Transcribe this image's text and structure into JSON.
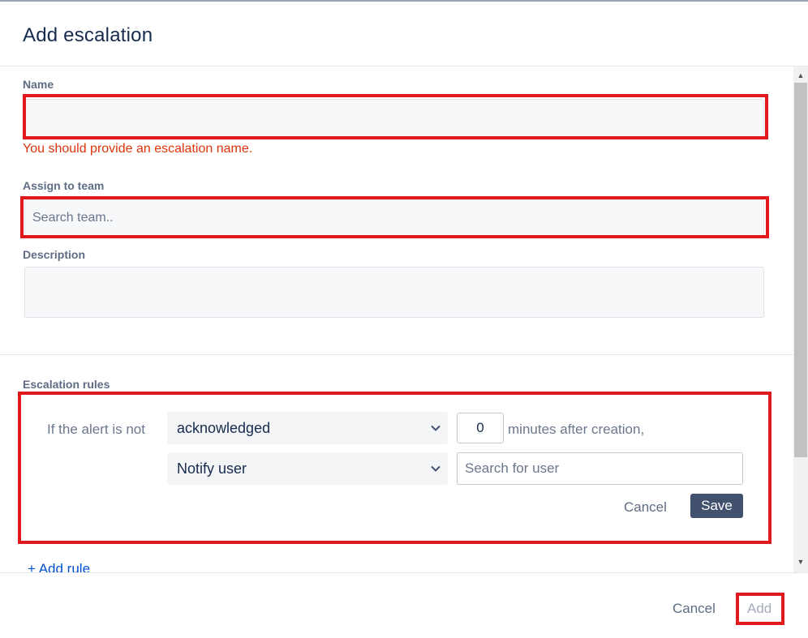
{
  "dialog": {
    "title": "Add escalation"
  },
  "form": {
    "name_label": "Name",
    "name_value": "",
    "name_error": "You should provide an escalation name.",
    "team_label": "Assign to team",
    "team_placeholder": "Search team..",
    "description_label": "Description",
    "description_value": ""
  },
  "rules": {
    "section_label": "Escalation rules",
    "condition_prefix": "If the alert is not",
    "condition_select": "acknowledged",
    "minutes_value": "0",
    "minutes_suffix": "minutes after creation,",
    "action_select": "Notify user",
    "user_placeholder": "Search for user",
    "cancel_label": "Cancel",
    "save_label": "Save",
    "add_rule_label": "+ Add rule"
  },
  "footer": {
    "cancel_label": "Cancel",
    "add_label": "Add"
  },
  "colors": {
    "accent": "#42526e",
    "error": "#de350b",
    "highlight": "#e2191c",
    "link": "#0052cc"
  },
  "icons": [
    "chevron-down-icon",
    "scroll-up-arrow-icon",
    "scroll-down-arrow-icon"
  ]
}
